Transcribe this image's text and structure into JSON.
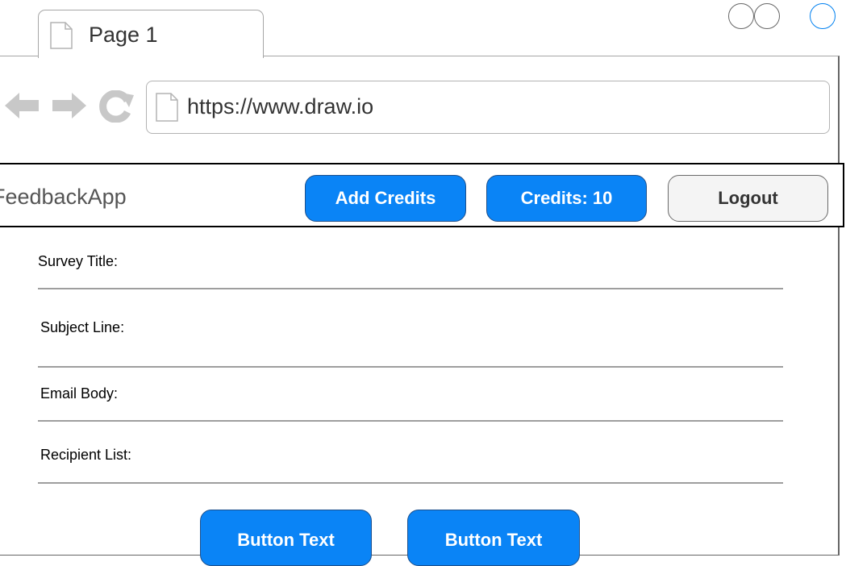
{
  "browser": {
    "tab_label": "Page 1",
    "address": "https://www.draw.io",
    "window_controls": [
      "minimize-circle",
      "maximize-circle",
      "close-circle"
    ],
    "icons": {
      "back": "arrow-left-icon",
      "forward": "arrow-right-icon",
      "reload": "reload-icon",
      "page": "page-icon"
    }
  },
  "app": {
    "brand": "FeedbackApp",
    "buttons": {
      "add_credits": "Add Credits",
      "credits": "Credits: 10",
      "logout": "Logout"
    }
  },
  "form": {
    "fields": [
      {
        "label": "Survey Title:"
      },
      {
        "label": "Subject Line:"
      },
      {
        "label": "Email Body:"
      },
      {
        "label": "Recipient List:"
      }
    ],
    "actions": [
      "Button Text",
      "Button Text"
    ]
  },
  "colors": {
    "primary": "#0a84f6",
    "primary_border": "#1d4f8b",
    "neutral_button": "#f4f4f4",
    "nav_icon": "#c8c8c8",
    "active_control": "#0080f0"
  }
}
